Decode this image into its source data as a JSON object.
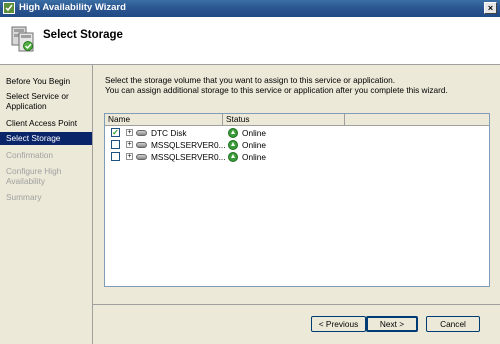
{
  "window": {
    "title": "High Availability Wizard",
    "close_label": "×"
  },
  "header": {
    "title": "Select Storage"
  },
  "sidebar": {
    "steps": [
      {
        "label": "Before You Begin",
        "state": "normal"
      },
      {
        "label": "Select Service or Application",
        "state": "normal"
      },
      {
        "label": "Client Access Point",
        "state": "normal"
      },
      {
        "label": "Select Storage",
        "state": "active"
      },
      {
        "label": "Confirmation",
        "state": "disabled"
      },
      {
        "label": "Configure High Availability",
        "state": "disabled"
      },
      {
        "label": "Summary",
        "state": "disabled"
      }
    ]
  },
  "main": {
    "instruction_line1": "Select the storage volume that you want to assign to this service or application.",
    "instruction_line2": "You can assign additional storage to this service or application after you complete this wizard.",
    "columns": [
      "Name",
      "Status"
    ],
    "rows": [
      {
        "name": "DTC Disk",
        "status": "Online",
        "checked": true
      },
      {
        "name": "MSSQLSERVER0...",
        "status": "Online",
        "checked": false
      },
      {
        "name": "MSSQLSERVER0...",
        "status": "Online",
        "checked": false
      }
    ]
  },
  "buttons": {
    "previous": "< Previous",
    "next": "Next >",
    "cancel": "Cancel"
  },
  "colors": {
    "titlebar": "#2a5590",
    "selection": "#0a246a",
    "status_ok": "#3a9d3a"
  },
  "icons": {
    "app": "wizard-app-icon",
    "header": "cluster-wizard-icon",
    "status": "online-status-icon",
    "disk": "disk-icon"
  }
}
